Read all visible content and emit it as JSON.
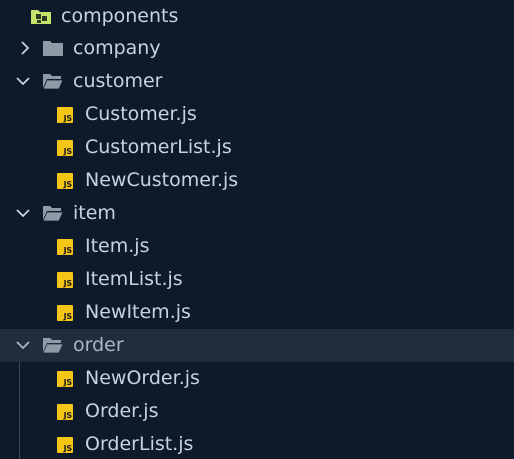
{
  "explorer": {
    "root": {
      "label": "components",
      "icon": "components-folder-icon",
      "state": "expanded"
    },
    "folders": {
      "company": {
        "label": "company",
        "state": "collapsed"
      },
      "customer": {
        "label": "customer",
        "state": "expanded",
        "files": [
          "Customer.js",
          "CustomerList.js",
          "NewCustomer.js"
        ]
      },
      "item": {
        "label": "item",
        "state": "expanded",
        "files": [
          "Item.js",
          "ItemList.js",
          "NewItem.js"
        ]
      },
      "order": {
        "label": "order",
        "state": "expanded",
        "selected": true,
        "files": [
          "NewOrder.js",
          "Order.js",
          "OrderList.js"
        ]
      }
    },
    "file_badge": "JS"
  },
  "colors": {
    "background": "#0d1a2a",
    "selected_row": "#1f2d3d",
    "text": "#c7d3de",
    "js_badge": "#f5c518",
    "folder": "#8e9aa6",
    "root_folder": "#c5e26a"
  }
}
